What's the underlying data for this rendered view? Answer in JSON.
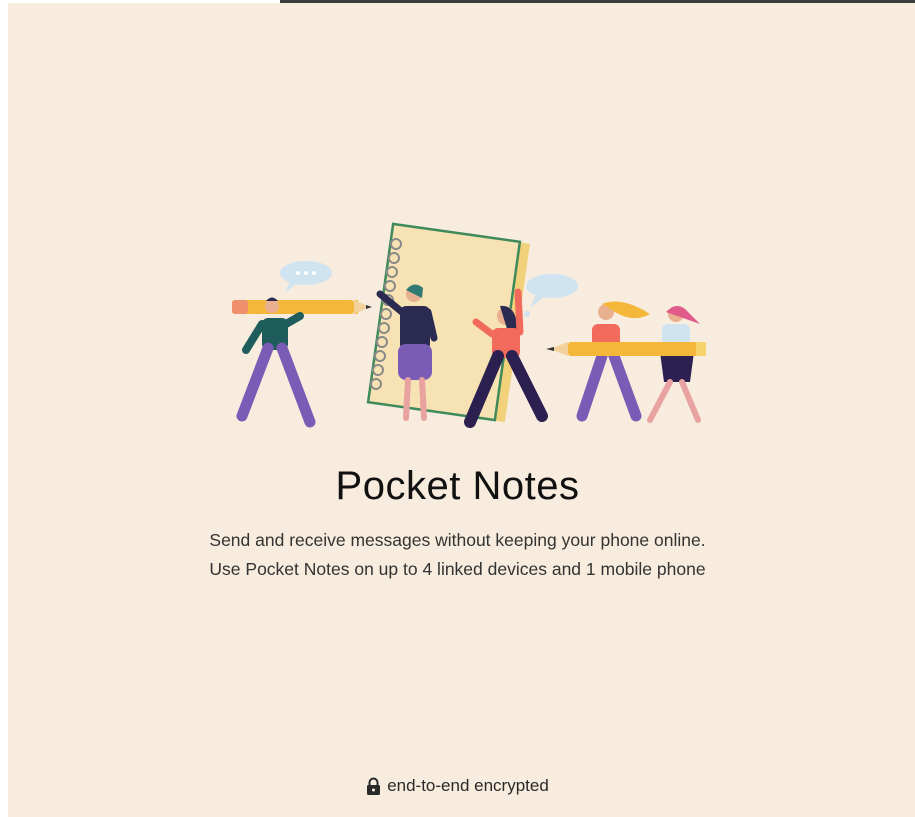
{
  "app": {
    "title": "Pocket Notes",
    "description_line1": "Send and receive messages without keeping your phone online.",
    "description_line2": "Use Pocket Notes on up to 4 linked devices and 1 mobile phone"
  },
  "footer": {
    "encryption_text": "end-to-end encrypted",
    "icon": "lock-icon"
  },
  "colors": {
    "background": "#f7ecdd",
    "title": "#111111",
    "text": "#333333"
  },
  "illustration": {
    "icon": "people-with-notebook-illustration"
  }
}
